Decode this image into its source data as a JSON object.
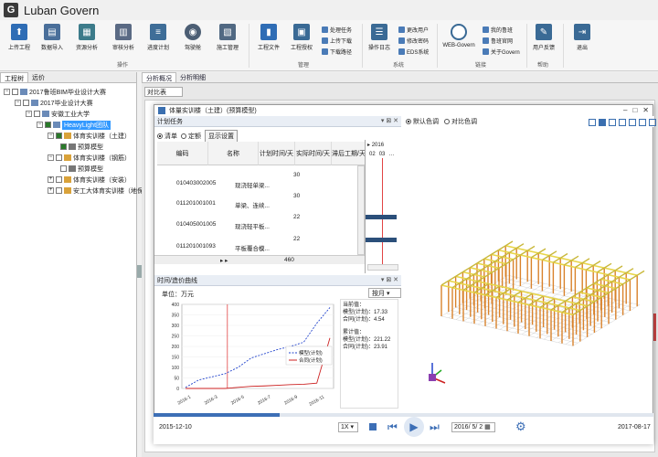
{
  "app": {
    "logo": "G",
    "title": "Luban Govern"
  },
  "ribbon": {
    "buttons": [
      {
        "id": "upload",
        "label": "上传工程",
        "color": "#2f6db5",
        "glyph": "⬆"
      },
      {
        "id": "import",
        "label": "数据导入",
        "color": "#4a6f9a",
        "glyph": "▤"
      },
      {
        "id": "resource",
        "label": "资源分析",
        "color": "#3c7b8a",
        "glyph": "▦"
      },
      {
        "id": "audit",
        "label": "审核分析",
        "color": "#5a6a84",
        "glyph": "▥"
      },
      {
        "id": "progress",
        "label": "进度计划",
        "color": "#3f6e98",
        "glyph": "≡"
      },
      {
        "id": "tool",
        "label": "驾驶舱",
        "color": "#4c5e74",
        "glyph": "◉"
      },
      {
        "id": "construct",
        "label": "施工管理",
        "color": "#516983",
        "glyph": "▧"
      },
      {
        "id": "files",
        "label": "工程文件",
        "color": "#2f6db5",
        "glyph": "▮"
      },
      {
        "id": "eng",
        "label": "工程授权",
        "color": "#3a6a95",
        "glyph": "▣"
      },
      {
        "id": "log",
        "label": "操作日志",
        "color": "#3a6a95",
        "glyph": "☰"
      },
      {
        "id": "web",
        "label": "WEB-Govern",
        "color": "#fff",
        "glyph": "◯"
      },
      {
        "id": "feedback",
        "label": "用户反馈",
        "color": "#3a6a95",
        "glyph": "✎"
      },
      {
        "id": "exit",
        "label": "退出",
        "color": "#3a6a95",
        "glyph": "⇥"
      }
    ],
    "small_items": {
      "task": "处理任务",
      "upload_dl": "上传下载",
      "dl_path": "下载路径",
      "change_user": "更改用户",
      "change_pwd": "修改密码",
      "eds": "EDS系统",
      "my_lb": "我的鲁班",
      "lb_official": "鲁班官网",
      "about": "关于Govern"
    },
    "groups": {
      "ops": "操作",
      "manage": "管理",
      "system": "系统",
      "link": "链接",
      "help": "帮助"
    }
  },
  "left": {
    "tabs": [
      "工程树",
      "远价"
    ],
    "tree": [
      {
        "label": "2017鲁班BIM毕业设计大赛",
        "level": 0
      },
      {
        "label": "2017毕业设计大赛",
        "level": 1
      },
      {
        "label": "安徽工业大学",
        "level": 2
      },
      {
        "label": "HeavyLight团队",
        "level": 3
      },
      {
        "label": "体育实训楼（土建）",
        "level": 4
      },
      {
        "label": "预算模型",
        "level": 5
      },
      {
        "label": "体育实训楼（钢筋）",
        "level": 4
      },
      {
        "label": "预算模型",
        "level": 5
      },
      {
        "label": "体育实训楼（安装）",
        "level": 4
      },
      {
        "label": "安工大体育实训楼（地保水",
        "level": 4
      }
    ]
  },
  "main": {
    "tabs": [
      "分析概况",
      "分析明细"
    ],
    "compare": "对比表"
  },
  "dialog": {
    "title": "体量实训楼（土建）(预算模型)",
    "plan_title": "计划任务",
    "plan_radios": [
      "清单",
      "定额"
    ],
    "plan_btn": "显示设置",
    "table_headers": [
      "编码",
      "名称",
      "计划时间/天",
      "实际时间/天",
      "滞后工期/天"
    ],
    "rows": [
      {
        "code": "010403002005",
        "name": "现浇轻单梁...",
        "plan": "30"
      },
      {
        "code": "011201001001",
        "name": "单梁、连续...",
        "plan": "30"
      },
      {
        "code": "010405001005",
        "name": "现浇轻平板...",
        "plan": "22"
      },
      {
        "code": "011201001093",
        "name": "平板覆合模...",
        "plan": "22"
      }
    ],
    "total": "460",
    "gantt_year": "2016",
    "gantt_ticks": [
      "02",
      "03"
    ],
    "curve_title": "时间/造价曲线",
    "unit_label": "单位：万元",
    "period": "按月",
    "y_ticks": [
      "0",
      "50",
      "100",
      "150",
      "200",
      "250",
      "300",
      "350",
      "400"
    ],
    "x_ticks": [
      "2016-1",
      "2016-3",
      "2016-5",
      "2016-7",
      "2016-9",
      "2016-11"
    ],
    "legend": [
      "模型(计划)",
      "合同(计划)"
    ],
    "current": {
      "header": "当前值：",
      "model": "模型(计划)：17.33",
      "contract": "合同(计划)：4.54",
      "acc": "累计值：",
      "model_acc": "模型(计划)：221.22",
      "contract_acc": "合同(计划)：23.91"
    },
    "view_radios": [
      "默认色调",
      "对比色调"
    ],
    "start_date": "2015-12-10",
    "end_date": "2017-08-17",
    "speed": "1X",
    "current_date": "2016/ 5/ 2"
  },
  "chart_data": {
    "type": "line",
    "x": [
      "2016-1",
      "2016-2",
      "2016-3",
      "2016-4",
      "2016-5",
      "2016-6",
      "2016-7",
      "2016-8",
      "2016-9",
      "2016-10",
      "2016-11",
      "2016-12"
    ],
    "series": [
      {
        "name": "模型(计划)",
        "values": [
          5,
          40,
          55,
          70,
          100,
          145,
          165,
          185,
          200,
          220,
          310,
          385
        ]
      },
      {
        "name": "合同(计划)",
        "values": [
          0,
          0,
          0,
          0,
          5,
          10,
          12,
          15,
          18,
          20,
          25,
          240
        ]
      }
    ],
    "ylim": [
      0,
      400
    ],
    "colors": [
      "#2244cc",
      "#cc2222"
    ]
  }
}
